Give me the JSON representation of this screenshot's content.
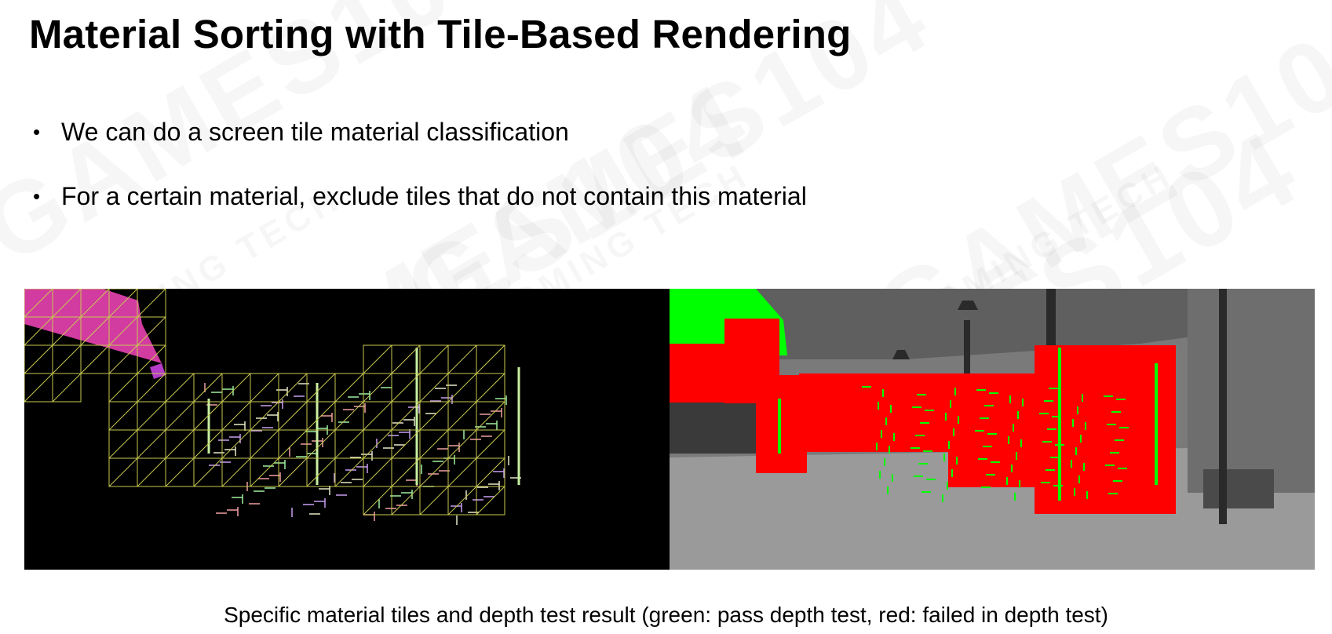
{
  "slide": {
    "title": "Material Sorting with Tile-Based Rendering",
    "bullets": [
      "We can do a screen tile material classification",
      "For a certain material, exclude tiles that do not contain this material"
    ],
    "bullet_marker": "•",
    "caption": "Specific material tiles and depth test result (green: pass depth test, red: failed in depth test)"
  },
  "watermark": {
    "text": "GAMES104",
    "subtext": "BOOMING TECH"
  },
  "images": {
    "left": {
      "name": "material-tile-classification-image",
      "tile_color": "#c8c850",
      "background": "#000000"
    },
    "right": {
      "name": "depth-test-result-image",
      "pass_color": "#00ff00",
      "fail_color": "#ff0000",
      "background": "#808080"
    }
  }
}
